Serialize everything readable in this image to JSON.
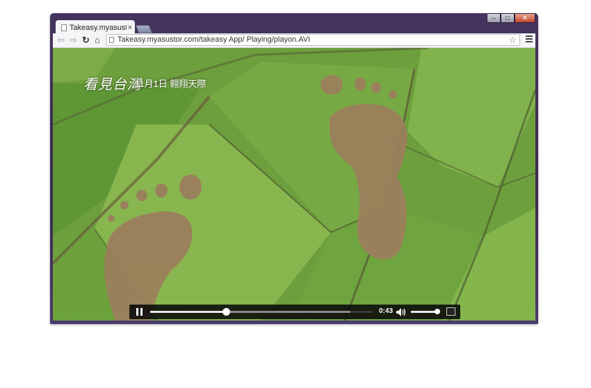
{
  "browser": {
    "tab_title": "Takeasy.myasusto...",
    "tab_close": "×",
    "url": "Takeasy.myasustor.com/takeasy App/ Playing/playon.AVI",
    "window_controls": [
      "minimize",
      "maximize",
      "close"
    ],
    "icons": [
      "back-icon",
      "forward-icon",
      "reload-icon",
      "home-icon",
      "star-icon",
      "menu-icon"
    ]
  },
  "video": {
    "caption_logo": "看見台灣",
    "caption_date": "11月1日  翱翔天際",
    "current_time": "0:43",
    "progress": 0.34,
    "buffered": 0.9,
    "volume": 0.95
  },
  "colors": {
    "frame": "#3a2b52",
    "field": "#6a9e3a",
    "footprint": "#9a7e5a"
  }
}
